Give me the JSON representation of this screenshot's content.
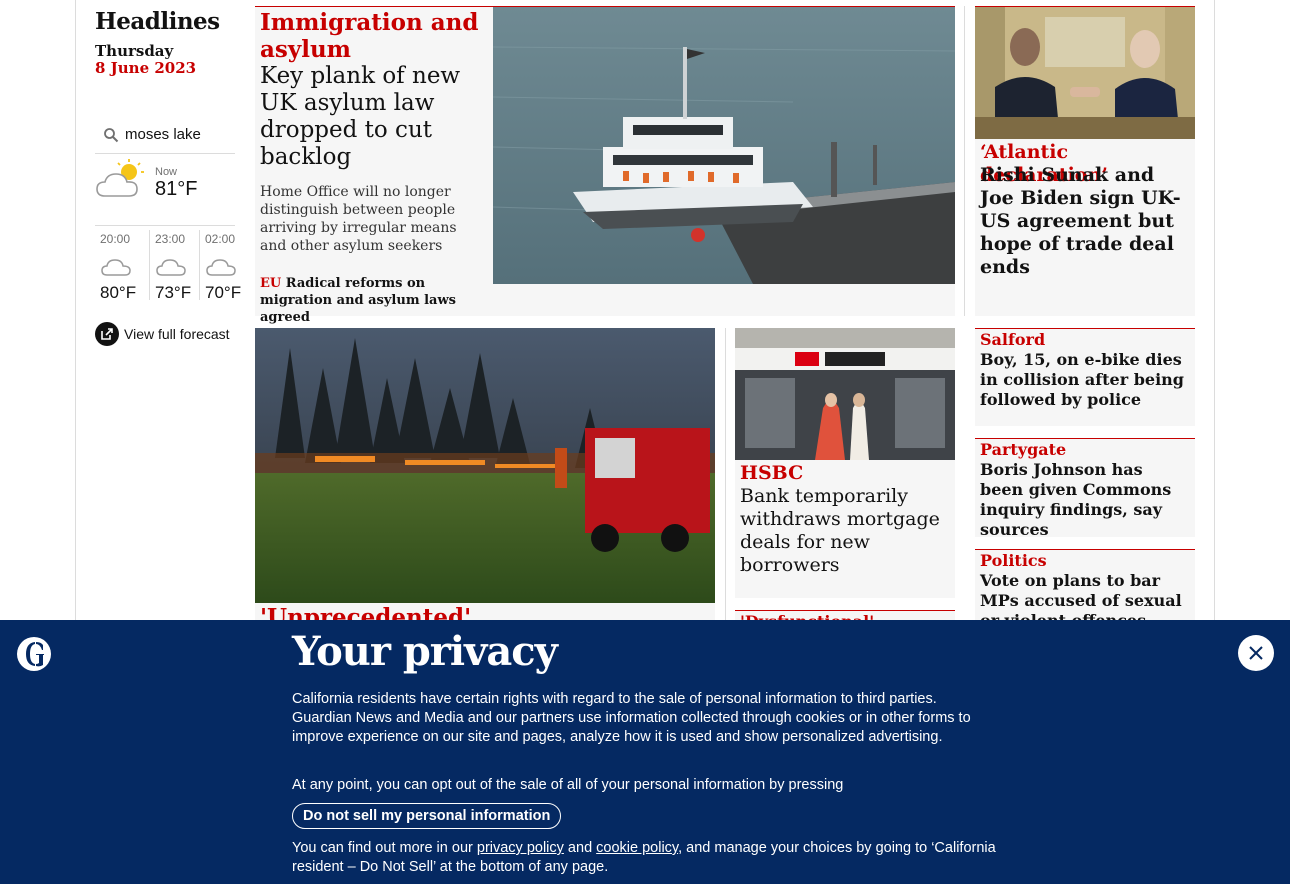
{
  "sidebar": {
    "title": "Headlines",
    "day": "Thursday",
    "date": "8 June 2023",
    "weather": {
      "location": "moses lake",
      "now_label": "Now",
      "now_temp": "81°F",
      "forecast": [
        {
          "time": "20:00",
          "temp": "80°F"
        },
        {
          "time": "23:00",
          "temp": "73°F"
        },
        {
          "time": "02:00",
          "temp": "70°F"
        }
      ],
      "full_forecast_label": "View full forecast"
    }
  },
  "main_story": {
    "kicker": "Immigration and asylum",
    "headline": "Key plank of new UK asylum law dropped to cut backlog",
    "standfirst": "Home Office will no longer distinguish between people arriving by irregular means and other asylum seekers",
    "sub_kicker": "EU",
    "sub_headline": "Radical reforms on migration and asylum laws agreed"
  },
  "side_story": {
    "kicker": "‘Atlantic declaration’",
    "headline": "Rishi Sunak and Joe Biden sign UK-US agreement but hope of trade deal ends"
  },
  "small_stories": [
    {
      "kicker": "Salford",
      "headline": "Boy, 15, on e-bike dies in collision after being followed by police"
    },
    {
      "kicker": "Partygate",
      "headline": "Boris Johnson has been given Commons inquiry findings, say sources"
    },
    {
      "kicker": "Politics",
      "headline": "Vote on plans to bar MPs accused of sexual or violent offences delayed"
    }
  ],
  "fire_story": {
    "kicker": "'Unprecedented'"
  },
  "hsbc_story": {
    "kicker": "HSBC",
    "headline": "Bank temporarily withdraws mortgage deals for new borrowers"
  },
  "dysf_story": {
    "kicker": "'Dysfunctional'"
  },
  "privacy": {
    "title": "Your privacy",
    "para1": "California residents have certain rights with regard to the sale of personal information to third parties. Guardian News and Media and our partners use information collected through cookies or in other forms to improve experience on our site and pages, analyze how it is used and show personalized advertising.",
    "para2": "At any point, you can opt out of the sale of all of your personal information by pressing",
    "button": "Do not sell my personal information",
    "para3_pre": "You can find out more in our ",
    "privacy_link": "privacy policy",
    "and": " and ",
    "cookie_link": "cookie policy",
    "para3_post": ", and manage your choices by going to ‘California resident – Do Not Sell’ at the bottom of any page."
  },
  "colors": {
    "accent": "#c70000",
    "banner": "#052962",
    "card_bg": "#f6f6f6"
  }
}
